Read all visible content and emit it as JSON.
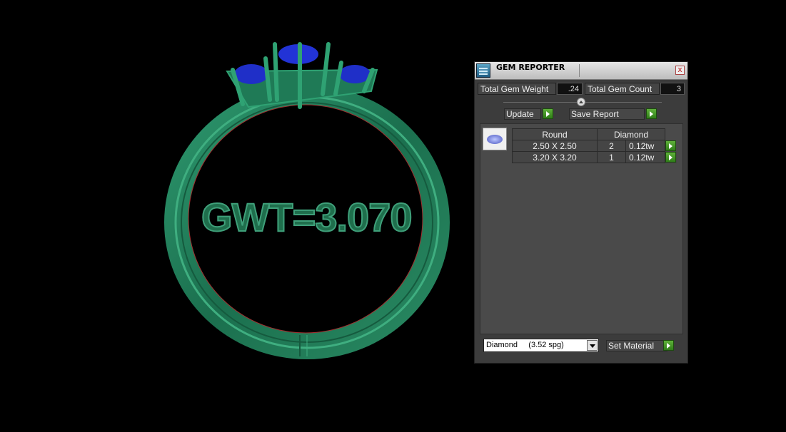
{
  "viewport": {
    "engraving_text": "GWT=3.070",
    "ring_color": "#1f7a56",
    "gem_color": "#1f2fc8"
  },
  "panel": {
    "title": "GEM REPORTER",
    "close_glyph": "x",
    "total_gem_weight_label": "Total Gem Weight",
    "total_gem_weight_value": ".24",
    "total_gem_count_label": "Total Gem Count",
    "total_gem_count_value": "3",
    "update_label": "Update",
    "save_report_label": "Save Report",
    "table": {
      "headers": [
        "Round",
        "Diamond"
      ],
      "rows": [
        {
          "size": "2.50 X 2.50",
          "qty": "2",
          "weight": "0.12tw"
        },
        {
          "size": "3.20 X 3.20",
          "qty": "1",
          "weight": "0.12tw"
        }
      ]
    },
    "material_select_value": "Diamond     (3.52 spg)",
    "set_material_label": "Set Material",
    "accent_color": "#3f9a26"
  }
}
